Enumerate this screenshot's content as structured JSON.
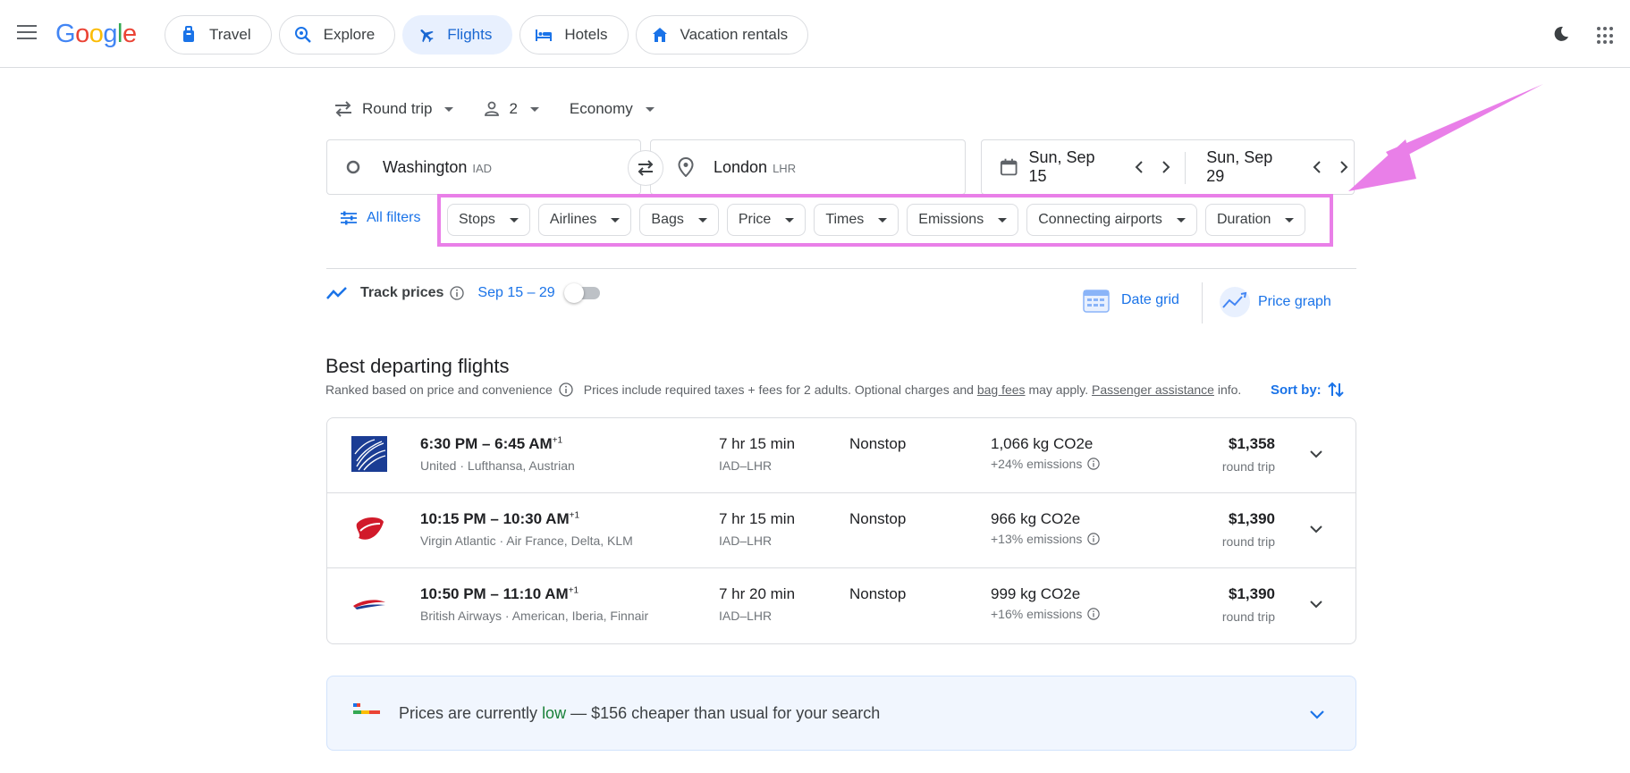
{
  "header": {
    "logo": [
      "G",
      "o",
      "o",
      "g",
      "l",
      "e"
    ],
    "nav": [
      {
        "label": "Travel",
        "icon": "luggage-icon"
      },
      {
        "label": "Explore",
        "icon": "explore-icon"
      },
      {
        "label": "Flights",
        "icon": "airplane-icon",
        "active": true
      },
      {
        "label": "Hotels",
        "icon": "bed-icon"
      },
      {
        "label": "Vacation rentals",
        "icon": "house-icon"
      }
    ]
  },
  "search": {
    "trip_type": "Round trip",
    "passengers": "2",
    "cabin": "Economy",
    "origin": {
      "city": "Washington",
      "code": "IAD"
    },
    "destination": {
      "city": "London",
      "code": "LHR"
    },
    "depart_date": "Sun, Sep 15",
    "return_date": "Sun, Sep 29"
  },
  "filters": {
    "all_filters": "All filters",
    "items": [
      "Stops",
      "Airlines",
      "Bags",
      "Price",
      "Times",
      "Emissions",
      "Connecting airports",
      "Duration"
    ]
  },
  "track": {
    "label": "Track prices",
    "range": "Sep 15 – 29",
    "enabled": false,
    "date_grid": "Date grid",
    "price_graph": "Price graph"
  },
  "results": {
    "title": "Best departing flights",
    "ranked": "Ranked based on price and convenience",
    "note_pre": "Prices include required taxes + fees for 2 adults. Optional charges and ",
    "bag_fees": "bag fees",
    "note_mid": " may apply. ",
    "passenger_assistance": "Passenger assistance",
    "note_post": " info.",
    "sort_by": "Sort by:",
    "flights": [
      {
        "times": "6:30 PM – 6:45 AM",
        "plus": "+1",
        "airlines": "United · Lufthansa, Austrian",
        "duration": "7 hr 15 min",
        "route": "IAD–LHR",
        "stops": "Nonstop",
        "co2": "1,066 kg CO2e",
        "emissions": "+24% emissions",
        "price": "$1,358",
        "trip": "round trip",
        "logo": "united-logo"
      },
      {
        "times": "10:15 PM – 10:30 AM",
        "plus": "+1",
        "airlines": "Virgin Atlantic · Air France, Delta, KLM",
        "duration": "7 hr 15 min",
        "route": "IAD–LHR",
        "stops": "Nonstop",
        "co2": "966 kg CO2e",
        "emissions": "+13% emissions",
        "price": "$1,390",
        "trip": "round trip",
        "logo": "virgin-logo"
      },
      {
        "times": "10:50 PM – 11:10 AM",
        "plus": "+1",
        "airlines": "British Airways · American, Iberia, Finnair",
        "duration": "7 hr 20 min",
        "route": "IAD–LHR",
        "stops": "Nonstop",
        "co2": "999 kg CO2e",
        "emissions": "+16% emissions",
        "price": "$1,390",
        "trip": "round trip",
        "logo": "british-airways-logo"
      }
    ]
  },
  "insight": {
    "pre": "Prices are currently ",
    "low": "low",
    "post": " — $156 cheaper than usual for your search"
  },
  "colors": {
    "accent": "#1a73e8",
    "highlight": "#e97fe8",
    "low_green": "#188038"
  }
}
